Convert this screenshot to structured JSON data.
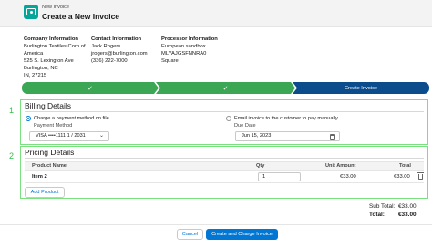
{
  "header": {
    "subtitle": "New Invoice",
    "title": "Create a New Invoice",
    "icon": "invoice-icon"
  },
  "company": {
    "title": "Company Information",
    "lines": [
      "Burlington Textiles Corp of",
      "America",
      "525 S. Lexington Ave",
      "Burlington, NC",
      "IN, 27215"
    ]
  },
  "contact": {
    "title": "Contact Information",
    "lines": [
      "Jack Rogers",
      "jrogers@burlington.com",
      "(336) 222-7000"
    ]
  },
  "processor": {
    "title": "Processor Information",
    "lines": [
      "European sandbox",
      "MLYAJGSFNNRA0",
      "Square"
    ]
  },
  "path": {
    "steps": [
      {
        "label": "",
        "status": "complete"
      },
      {
        "label": "",
        "status": "complete"
      },
      {
        "label": "Create Invoice",
        "status": "current"
      }
    ],
    "colors": {
      "complete": "#3ba755",
      "current": "#0b4c8c"
    }
  },
  "annotations": {
    "billing_marker": "1",
    "pricing_marker": "2"
  },
  "billing": {
    "title": "Billing Details",
    "option_charge": "Charge a payment method on file",
    "payment_method_label": "Payment Method",
    "payment_method_value": "VISA ••••1111 1 / 2031",
    "option_email": "Email invoice to the customer to pay manually",
    "due_date_label": "Due Date",
    "due_date_value": "Jun 15, 2023"
  },
  "pricing": {
    "title": "Pricing Details",
    "columns": {
      "product": "Product Name",
      "qty": "Qty",
      "unit": "Unit Amount",
      "total": "Total"
    },
    "rows": [
      {
        "product": "Item 2",
        "qty": "1",
        "unit": "€33.00",
        "total": "€33.00"
      }
    ],
    "add_product": "Add Product"
  },
  "totals": {
    "subtotal_label": "Sub Total:",
    "subtotal_value": "€33.00",
    "total_label": "Total:",
    "total_value": "€33.00"
  },
  "footer": {
    "cancel": "Cancel",
    "submit": "Create and Charge Invoice"
  }
}
